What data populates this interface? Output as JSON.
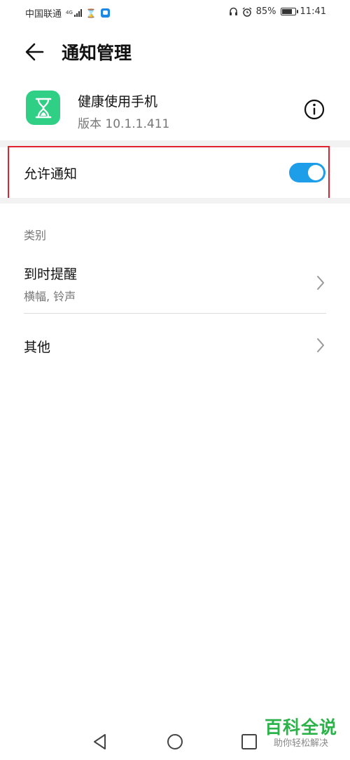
{
  "status_bar": {
    "carrier": "中国联通",
    "network": "4G",
    "battery_percent": "85%",
    "battery_level": 0.85,
    "time": "11:41",
    "icons": [
      "signal-icon",
      "hourglass-icon",
      "message-app-icon",
      "headset-icon",
      "alarm-icon",
      "battery-icon"
    ]
  },
  "header": {
    "title": "通知管理",
    "back_icon": "arrow-left-icon"
  },
  "app": {
    "name": "健康使用手机",
    "version": "版本 10.1.1.411",
    "icon": "hourglass-icon",
    "icon_color": "#2fcf86",
    "info_icon": "info-circle-icon"
  },
  "allow_notifications": {
    "label": "允许通知",
    "enabled": true,
    "toggle_color": "#1e9de8",
    "highlight_color": "#e0232f"
  },
  "category": {
    "label": "类别",
    "items": [
      {
        "title": "到时提醒",
        "subtitle": "横幅, 铃声"
      },
      {
        "title": "其他"
      }
    ]
  },
  "nav_bar": {
    "icons": [
      "nav-back-icon",
      "nav-home-icon",
      "nav-recents-icon"
    ]
  },
  "watermark": {
    "main": "百科全说",
    "sub": "助你轻松解决",
    "color": "#2bb34a"
  }
}
